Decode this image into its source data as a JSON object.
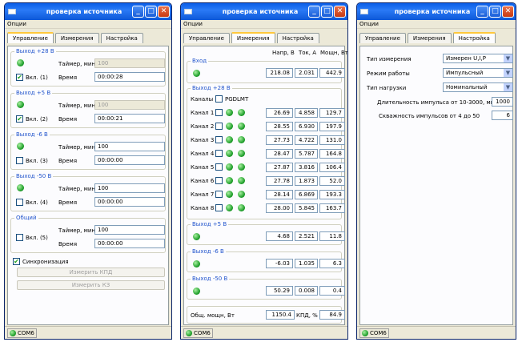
{
  "title": "проверка источника",
  "menu": "Опции",
  "tabs": [
    "Управление",
    "Измерения",
    "Настройка"
  ],
  "status_port": "COM6",
  "control": {
    "groups": [
      {
        "label": "Выход +28 В",
        "timer_label": "Таймер, мин",
        "timer": "100",
        "enable": "Вкл. (1)",
        "checked": true,
        "time_label": "Время",
        "time": "00:00:28"
      },
      {
        "label": "Выход +5 В",
        "timer_label": "Таймер, мин",
        "timer": "100",
        "enable": "Вкл. (2)",
        "checked": true,
        "time_label": "Время",
        "time": "00:00:21"
      },
      {
        "label": "Выход -6 В",
        "timer_label": "Таймер, мин",
        "timer": "100",
        "enable": "Вкл. (3)",
        "checked": false,
        "time_label": "Время",
        "time": "00:00:00"
      },
      {
        "label": "Выход -50 В",
        "timer_label": "Таймер, мин",
        "timer": "100",
        "enable": "Вкл. (4)",
        "checked": false,
        "time_label": "Время",
        "time": "00:00:00"
      }
    ],
    "common": {
      "label": "Общий",
      "timer_label": "Таймер, мин",
      "timer": "100",
      "enable": "Вкл. (5)",
      "time_label": "Время",
      "time": "00:00:00"
    },
    "sync": "Синхронизация",
    "btn_kpd": "Измерить КПД",
    "btn_kz": "Измерить КЗ"
  },
  "meas": {
    "headers": [
      "Напр, В",
      "Ток, А",
      "Мощн, Вт"
    ],
    "input": {
      "label": "Вход",
      "v": "218.08",
      "i": "2.031",
      "p": "442.9"
    },
    "out28_label": "Выход +28 В",
    "channels_label": "Каналы",
    "pgd": "PGD",
    "lmt": "LMT",
    "channels": [
      {
        "name": "Канал 1",
        "v": "26.69",
        "i": "4.858",
        "p": "129.7"
      },
      {
        "name": "Канал 2",
        "v": "28.55",
        "i": "6.930",
        "p": "197.9"
      },
      {
        "name": "Канал 3",
        "v": "27.73",
        "i": "4.722",
        "p": "131.0"
      },
      {
        "name": "Канал 4",
        "v": "28.47",
        "i": "5.787",
        "p": "164.8"
      },
      {
        "name": "Канал 5",
        "v": "27.87",
        "i": "3.816",
        "p": "106.4"
      },
      {
        "name": "Канал 6",
        "v": "27.78",
        "i": "1.873",
        "p": "52.0"
      },
      {
        "name": "Канал 7",
        "v": "28.14",
        "i": "6.869",
        "p": "193.3"
      },
      {
        "name": "Канал 8",
        "v": "28.00",
        "i": "5.845",
        "p": "163.7"
      }
    ],
    "outs": [
      {
        "label": "Выход +5 В",
        "v": "4.68",
        "i": "2.521",
        "p": "11.8"
      },
      {
        "label": "Выход -6 В",
        "v": "-6.03",
        "i": "1.035",
        "p": "6.3"
      },
      {
        "label": "Выход -50 В",
        "v": "50.29",
        "i": "0.008",
        "p": "0.4"
      }
    ],
    "total_label": "Общ. мощн, Вт",
    "total": "1150.4",
    "kpd_label": "КПД, %",
    "kpd": "84.9"
  },
  "settings": {
    "meas_type_label": "Тип измерения",
    "meas_type": "Измерен U,I,P",
    "mode_label": "Режим работы",
    "mode": "Импульсный",
    "load_label": "Тип нагрузки",
    "load": "Номинальный",
    "pulse_label": "Длительность импульса от 10-3000, мкс.",
    "pulse": "1000",
    "duty_label": "Скважность импульсов от 4 до 50",
    "duty": "6"
  }
}
